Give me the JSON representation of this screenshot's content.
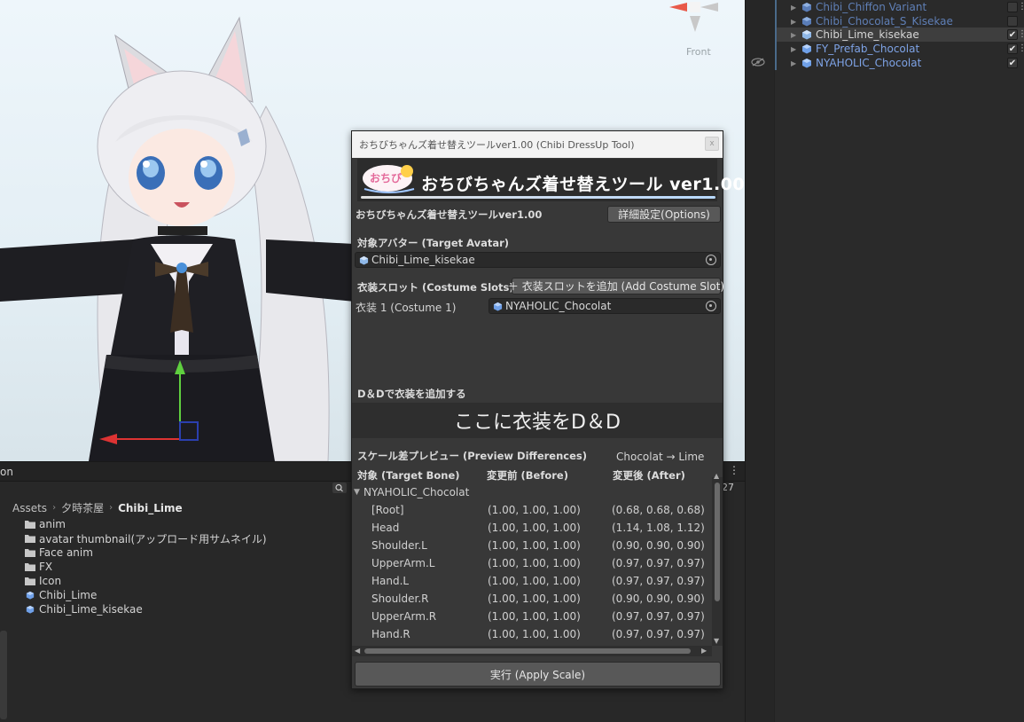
{
  "scene": {
    "gizmo_label": "Front"
  },
  "hierarchy": {
    "items": [
      {
        "label": "Chibi_Chiffon Variant",
        "kind": "variant",
        "checked": false
      },
      {
        "label": "Chibi_Chocolat_S_Kisekae",
        "kind": "variant",
        "checked": false
      },
      {
        "label": "Chibi_Lime_kisekae",
        "kind": "normal",
        "checked": true,
        "selected": true
      },
      {
        "label": "FY_Prefab_Chocolat",
        "kind": "prefab",
        "checked": true
      },
      {
        "label": "NYAHOLIC_Chocolat",
        "kind": "prefab",
        "checked": true
      }
    ]
  },
  "project": {
    "tab_label": "on",
    "count_label": "27",
    "breadcrumb": [
      "Assets",
      "夕時茶屋",
      "Chibi_Lime"
    ],
    "assets": [
      {
        "label": "anim",
        "type": "folder"
      },
      {
        "label": "avatar thumbnail(アップロード用サムネイル)",
        "type": "folder"
      },
      {
        "label": "Face anim",
        "type": "folder"
      },
      {
        "label": "FX",
        "type": "folder"
      },
      {
        "label": "Icon",
        "type": "folder"
      },
      {
        "label": "Chibi_Lime",
        "type": "prefab"
      },
      {
        "label": "Chibi_Lime_kisekae",
        "type": "prefab"
      }
    ]
  },
  "tool": {
    "window_title": "おちびちゃんズ着せ替えツールver1.00 (Chibi DressUp Tool)",
    "close": "x",
    "banner_text": "おちびちゃんズ着せ替えツール  ver1.00",
    "logo_text": "おちび",
    "subtitle": "おちびちゃんズ着せ替えツールver1.00",
    "options_button": "詳細設定(Options)",
    "target_avatar_label": "対象アバター (Target Avatar)",
    "target_avatar_value": "Chibi_Lime_kisekae",
    "costume_slots_label": "衣装スロット (Costume Slots)",
    "add_slot_button": "＋ 衣装スロットを追加 (Add Costume Slot)",
    "slot1_label": "衣装 1 (Costume 1)",
    "slot1_value": "NYAHOLIC_Chocolat",
    "dd_label": "D＆Dで衣装を追加する",
    "dropzone_text": "ここに衣装をD＆D",
    "preview_label": "スケール差プレビュー (Preview Differences)",
    "preview_mapping": "Chocolat → Lime",
    "col_bone": "対象 (Target Bone)",
    "col_before": "変更前 (Before)",
    "col_after": "変更後 (After)",
    "group_label": "NYAHOLIC_Chocolat",
    "rows": [
      {
        "bone": "[Root]",
        "before": "(1.00, 1.00, 1.00)",
        "after": "(0.68, 0.68, 0.68)"
      },
      {
        "bone": "Head",
        "before": "(1.00, 1.00, 1.00)",
        "after": "(1.14, 1.08, 1.12)"
      },
      {
        "bone": "Shoulder.L",
        "before": "(1.00, 1.00, 1.00)",
        "after": "(0.90, 0.90, 0.90)"
      },
      {
        "bone": "UpperArm.L",
        "before": "(1.00, 1.00, 1.00)",
        "after": "(0.97, 0.97, 0.97)"
      },
      {
        "bone": "Hand.L",
        "before": "(1.00, 1.00, 1.00)",
        "after": "(0.97, 0.97, 0.97)"
      },
      {
        "bone": "Shoulder.R",
        "before": "(1.00, 1.00, 1.00)",
        "after": "(0.90, 0.90, 0.90)"
      },
      {
        "bone": "UpperArm.R",
        "before": "(1.00, 1.00, 1.00)",
        "after": "(0.97, 0.97, 0.97)"
      },
      {
        "bone": "Hand.R",
        "before": "(1.00, 1.00, 1.00)",
        "after": "(0.97, 0.97, 0.97)"
      }
    ],
    "apply_button": "実行 (Apply Scale)"
  },
  "colors": {
    "prefab_text": "#7ea3e6",
    "variant_text": "#5f7fb6",
    "panel_bg": "#383838",
    "button_bg": "#585858"
  }
}
